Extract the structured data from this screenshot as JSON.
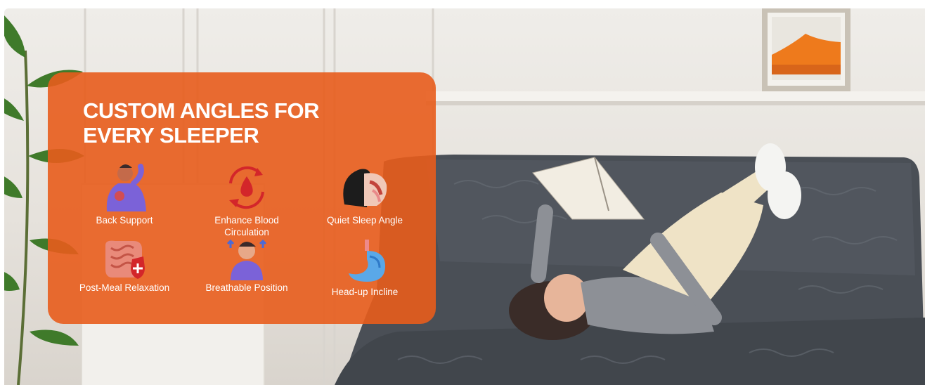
{
  "banner": {
    "headline": "CUSTOM ANGLES FOR EVERY SLEEPER",
    "accent_color": "#e85c1c",
    "sofa_color": "#4a4f56",
    "features": [
      {
        "label": "Back Support",
        "icon": "back-support-icon"
      },
      {
        "label": "Enhance Blood Circulation",
        "icon": "blood-circulation-icon"
      },
      {
        "label": "Quiet Sleep Angle",
        "icon": "quiet-sleep-icon"
      },
      {
        "label": "Post-Meal Relaxation",
        "icon": "digestion-icon"
      },
      {
        "label": "Breathable Position",
        "icon": "breathing-icon"
      },
      {
        "label": "Head-up Incline",
        "icon": "stomach-icon"
      }
    ]
  }
}
